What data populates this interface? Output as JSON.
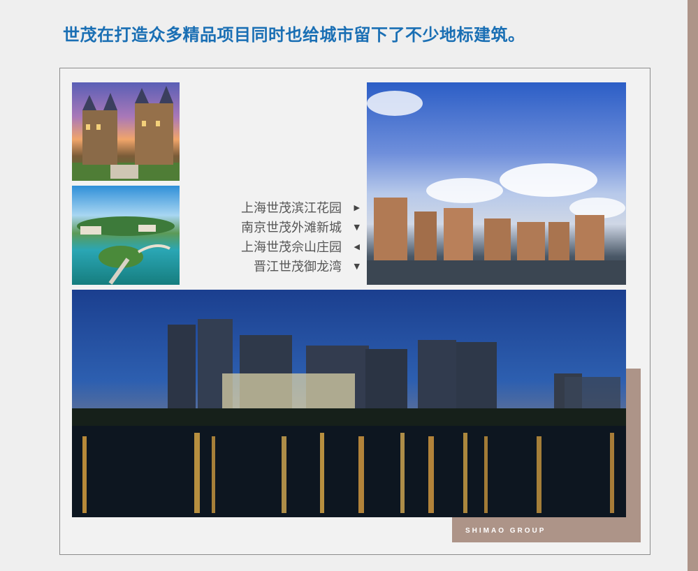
{
  "title": "世茂在打造众多精品项目同时也给城市留下了不少地标建筑。",
  "projects": [
    {
      "name": "上海世茂滨江花园",
      "arrow": "▶"
    },
    {
      "name": "南京世茂外滩新城",
      "arrow": "▼"
    },
    {
      "name": "上海世茂佘山庄园",
      "arrow": "◀"
    },
    {
      "name": "晋江世茂御龙湾",
      "arrow": "▼"
    }
  ],
  "brand": "SHIMAO GROUP",
  "colors": {
    "title": "#1a6fb4",
    "accent": "#ad9488",
    "frame_border": "#8c8c8c"
  }
}
